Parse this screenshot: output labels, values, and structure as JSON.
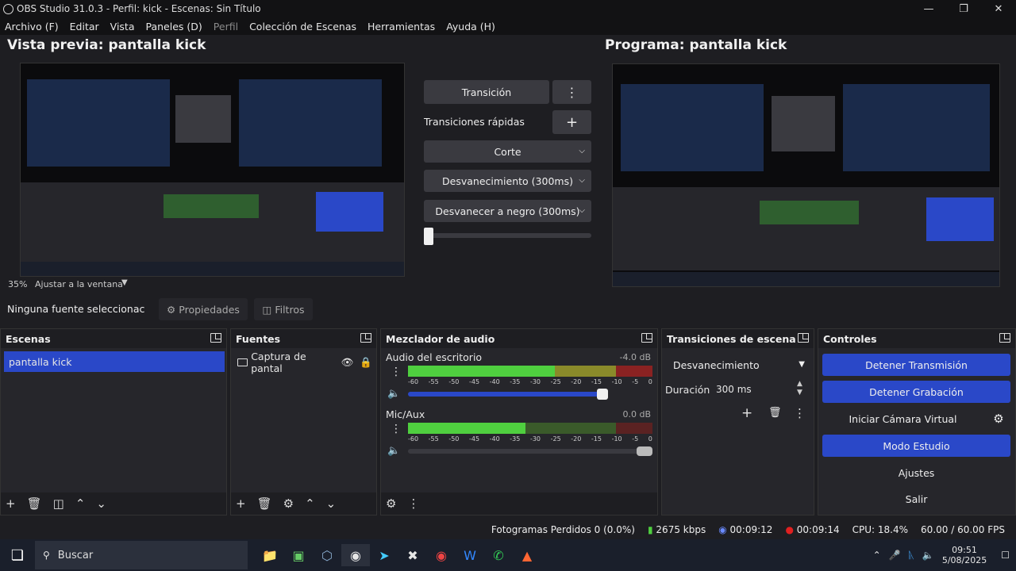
{
  "window": {
    "title": "OBS Studio 31.0.3 - Perfil: kick - Escenas: Sin Título"
  },
  "menu": {
    "items": [
      "Archivo (F)",
      "Editar",
      "Vista",
      "Paneles (D)",
      "Perfil",
      "Colección de Escenas",
      "Herramientas",
      "Ayuda (H)"
    ]
  },
  "preview": {
    "title": "Vista previa: pantalla kick",
    "zoom": "35%",
    "fit": "Ajustar a la ventana"
  },
  "program": {
    "title": "Programa: pantalla kick"
  },
  "transition_center": {
    "transition_btn": "Transición",
    "quick_label": "Transiciones rápidas",
    "options": [
      "Corte",
      "Desvanecimiento (300ms)",
      "Desvanecer a negro (300ms)"
    ]
  },
  "source_bar": {
    "none_selected": "Ninguna fuente seleccionac",
    "properties": "Propiedades",
    "filters": "Filtros"
  },
  "scenes": {
    "title": "Escenas",
    "items": [
      "pantalla kick"
    ]
  },
  "sources": {
    "title": "Fuentes",
    "items": [
      "Captura de pantal"
    ]
  },
  "mixer": {
    "title": "Mezclador de audio",
    "channels": [
      {
        "name": "Audio del escritorio",
        "db": "-4.0 dB"
      },
      {
        "name": "Mic/Aux",
        "db": "0.0 dB"
      }
    ],
    "scale": [
      "-60",
      "-55",
      "-50",
      "-45",
      "-40",
      "-35",
      "-30",
      "-25",
      "-20",
      "-15",
      "-10",
      "-5",
      "0"
    ]
  },
  "scene_transitions": {
    "title": "Transiciones de escena",
    "type": "Desvanecimiento",
    "duration_label": "Duración",
    "duration": "300 ms"
  },
  "controls": {
    "title": "Controles",
    "stop_stream": "Detener Transmisión",
    "stop_record": "Detener Grabación",
    "virtual_cam": "Iniciar Cámara Virtual",
    "studio_mode": "Modo Estudio",
    "settings": "Ajustes",
    "exit": "Salir"
  },
  "status": {
    "dropped": "Fotogramas Perdidos 0 (0.0%)",
    "bitrate": "2675 kbps",
    "stream_time": "00:09:12",
    "rec_time": "00:09:14",
    "cpu": "CPU: 18.4%",
    "fps": "60.00 / 60.00 FPS"
  },
  "taskbar": {
    "search": "Buscar",
    "time": "09:51",
    "date": "5/08/2025"
  },
  "colors": {
    "accent": "#2a48c8",
    "bg": "#1e1e22",
    "panel": "#26262b"
  }
}
